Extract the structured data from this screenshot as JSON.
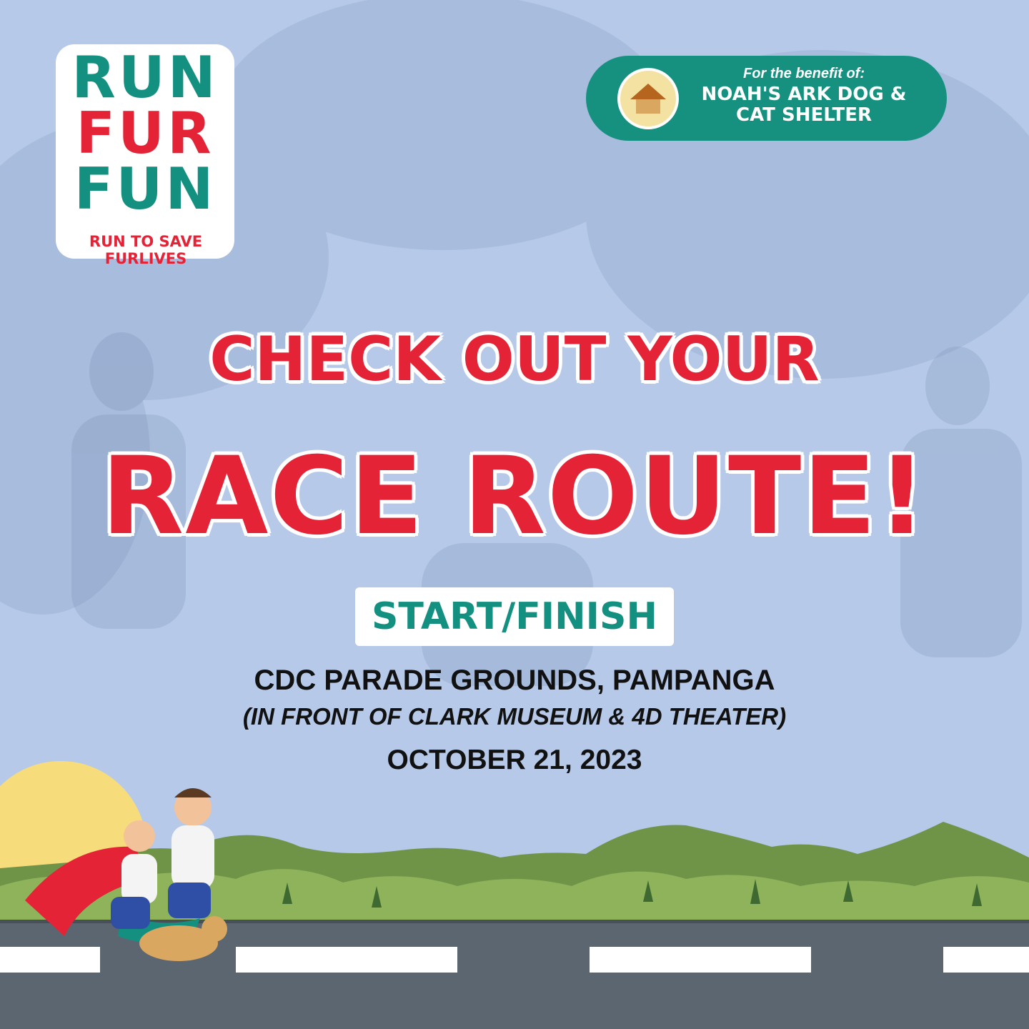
{
  "logo": {
    "line1": "RUN",
    "line2": "FUR",
    "line3": "FUN",
    "tagline": "RUN TO SAVE FURLIVES"
  },
  "benefit": {
    "subtitle": "For the benefit of:",
    "name": "NOAH'S ARK DOG & CAT SHELTER",
    "logo_icon": "shelter-logo-icon"
  },
  "headline": {
    "line1": "CHECK OUT YOUR",
    "line2": "RACE ROUTE!"
  },
  "start_finish": "START/FINISH",
  "venue": {
    "name": "CDC PARADE GROUNDS, PAMPANGA",
    "note": "(IN FRONT OF CLARK MUSEUM & 4D THEATER)",
    "date": "OCTOBER 21, 2023"
  },
  "colors": {
    "red": "#e42337",
    "teal": "#139080",
    "background": "#b4c7e6",
    "hills": "#6f9448",
    "road": "#5c6670",
    "sun": "#f7dc7c"
  }
}
